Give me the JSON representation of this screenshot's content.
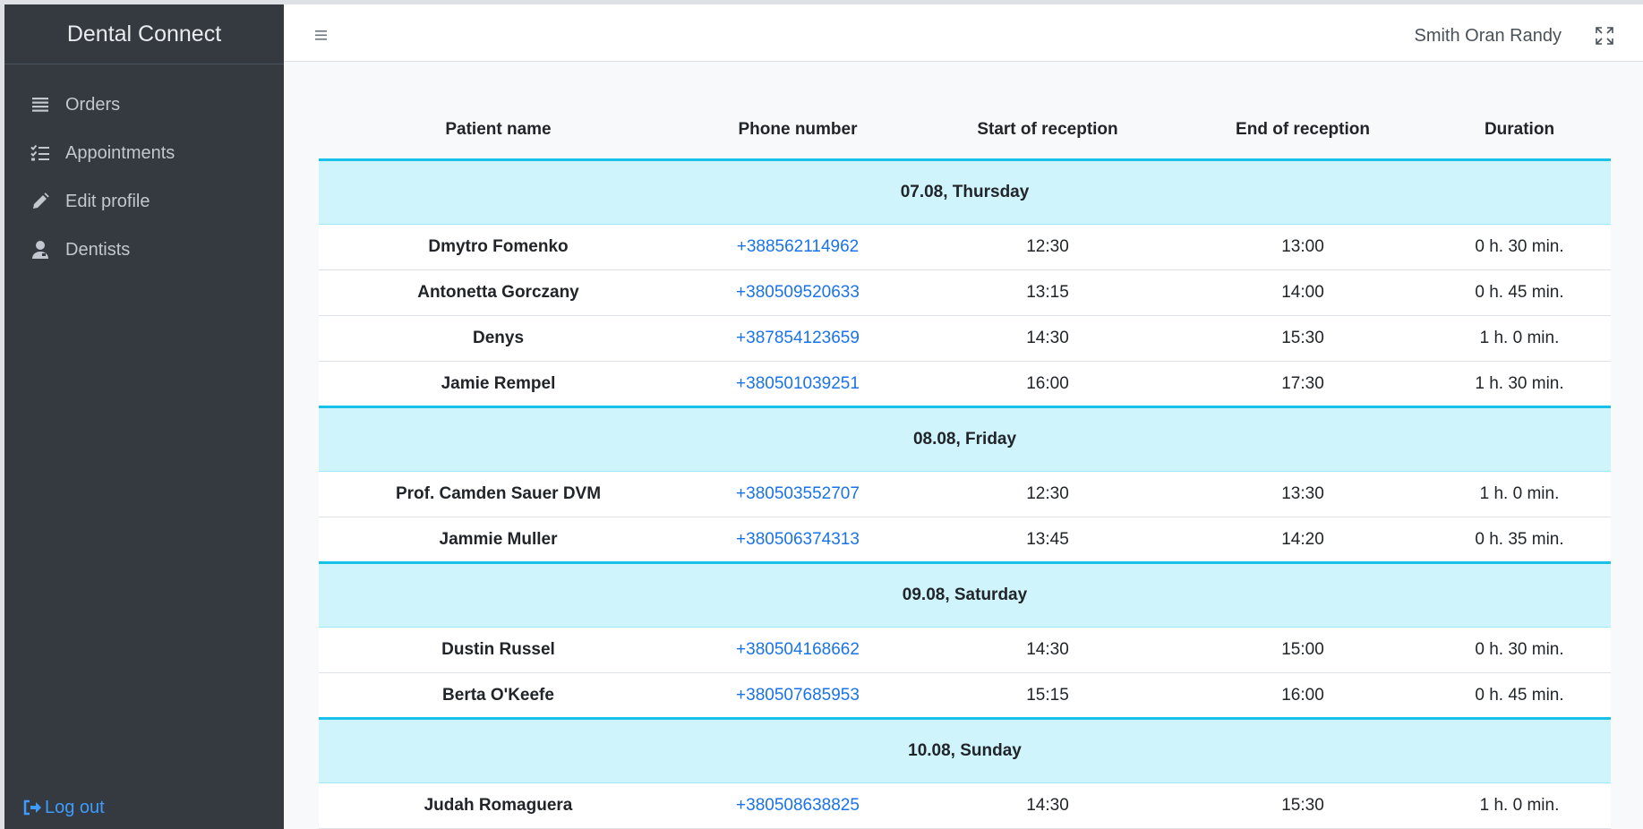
{
  "app": {
    "brand": "Dental Connect"
  },
  "sidebar": {
    "items": [
      {
        "label": "Orders",
        "icon": "list-icon"
      },
      {
        "label": "Appointments",
        "icon": "checklist-icon"
      },
      {
        "label": "Edit profile",
        "icon": "pencil-icon"
      },
      {
        "label": "Dentists",
        "icon": "doctor-icon"
      }
    ],
    "logout_label": "Log out"
  },
  "header": {
    "user_name": "Smith Oran Randy"
  },
  "table": {
    "columns": [
      "Patient name",
      "Phone number",
      "Start of reception",
      "End of reception",
      "Duration"
    ],
    "groups": [
      {
        "label": "07.08, Thursday",
        "rows": [
          [
            "Dmytro Fomenko",
            "+388562114962",
            "12:30",
            "13:00",
            "0 h. 30 min."
          ],
          [
            "Antonetta Gorczany",
            "+380509520633",
            "13:15",
            "14:00",
            "0 h. 45 min."
          ],
          [
            "Denys",
            "+387854123659",
            "14:30",
            "15:30",
            "1 h. 0 min."
          ],
          [
            "Jamie Rempel",
            "+380501039251",
            "16:00",
            "17:30",
            "1 h. 30 min."
          ]
        ]
      },
      {
        "label": "08.08, Friday",
        "rows": [
          [
            "Prof. Camden Sauer DVM",
            "+380503552707",
            "12:30",
            "13:30",
            "1 h. 0 min."
          ],
          [
            "Jammie Muller",
            "+380506374313",
            "13:45",
            "14:20",
            "0 h. 35 min."
          ]
        ]
      },
      {
        "label": "09.08, Saturday",
        "rows": [
          [
            "Dustin Russel",
            "+380504168662",
            "14:30",
            "15:00",
            "0 h. 30 min."
          ],
          [
            "Berta O'Keefe",
            "+380507685953",
            "15:15",
            "16:00",
            "0 h. 45 min."
          ]
        ]
      },
      {
        "label": "10.08, Sunday",
        "rows": [
          [
            "Judah Romaguera",
            "+380508638825",
            "14:30",
            "15:30",
            "1 h. 0 min."
          ]
        ]
      }
    ]
  }
}
